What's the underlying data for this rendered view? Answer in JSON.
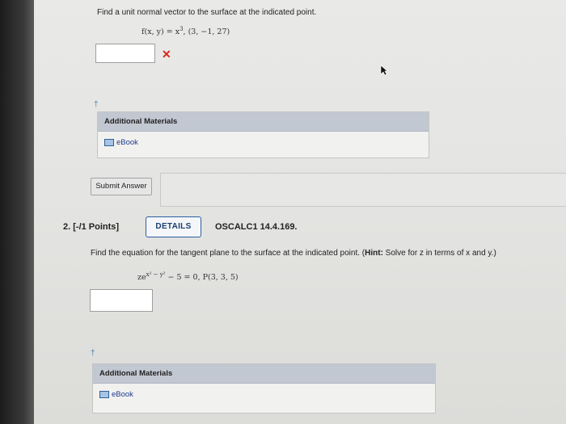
{
  "q1": {
    "prompt": "Find a unit normal vector to the surface at the indicated point.",
    "formula_lhs": "f(x, y) = x",
    "formula_exp": "3",
    "formula_point": ", (3, −1, 27)",
    "answer_value": "",
    "wrong_mark": "✕",
    "marker": "†",
    "materials": {
      "header": "Additional Materials",
      "ebook": "eBook"
    },
    "submit_label": "Submit Answer"
  },
  "q2": {
    "number": "2.",
    "points": "[-/1 Points]",
    "details_label": "DETAILS",
    "source": "OSCALC1 14.4.169.",
    "prompt_main": "Find the equation for the tangent plane to the surface at the indicated point. (",
    "prompt_hint_label": "Hint:",
    "prompt_hint": " Solve for z in terms of x and y.)",
    "formula_base": "ze",
    "formula_exp": "x² − y²",
    "formula_rest": " − 5 = 0,  P(3, 3, 5)",
    "answer_value": "",
    "marker": "†",
    "materials": {
      "header": "Additional Materials",
      "ebook": "eBook"
    }
  }
}
